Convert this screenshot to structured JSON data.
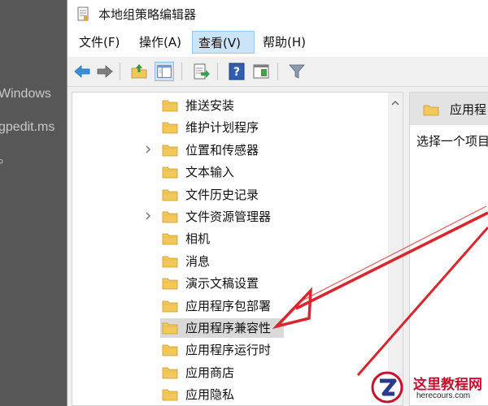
{
  "background_page": {
    "lines": [
      "Windows",
      "gpedit.ms",
      "。"
    ]
  },
  "window": {
    "title": "本地组策略编辑器"
  },
  "menubar": {
    "items": [
      {
        "label": "文件(F)"
      },
      {
        "label": "操作(A)"
      },
      {
        "label": "查看(V)"
      },
      {
        "label": "帮助(H)"
      }
    ],
    "active_index": 2
  },
  "toolbar": {
    "buttons": [
      "back-arrow-icon",
      "forward-arrow-icon",
      "up-folder-icon",
      "show-hide-tree-icon",
      "export-list-icon",
      "help-icon",
      "extended-view-icon",
      "filter-icon"
    ]
  },
  "tree": {
    "items": [
      {
        "label": "推送安装",
        "expandable": false
      },
      {
        "label": "维护计划程序",
        "expandable": false
      },
      {
        "label": "位置和传感器",
        "expandable": true
      },
      {
        "label": "文本输入",
        "expandable": false
      },
      {
        "label": "文件历史记录",
        "expandable": false
      },
      {
        "label": "文件资源管理器",
        "expandable": true
      },
      {
        "label": "相机",
        "expandable": false
      },
      {
        "label": "消息",
        "expandable": false
      },
      {
        "label": "演示文稿设置",
        "expandable": false
      },
      {
        "label": "应用程序包部署",
        "expandable": false
      },
      {
        "label": "应用程序兼容性",
        "expandable": false,
        "selected": true
      },
      {
        "label": "应用程序运行时",
        "expandable": false
      },
      {
        "label": "应用商店",
        "expandable": false
      },
      {
        "label": "应用隐私",
        "expandable": false
      }
    ]
  },
  "right_pane": {
    "header_label": "应用程",
    "description": "选择一个项目"
  },
  "watermark": {
    "title": "这里教程网",
    "url": "herecours.com"
  },
  "colors": {
    "folder": "#f2c85b",
    "folder_dark": "#d9a93a",
    "arrow": "#d9262c",
    "selection": "#d9d9d9",
    "menu_active": "#cce4f7"
  }
}
